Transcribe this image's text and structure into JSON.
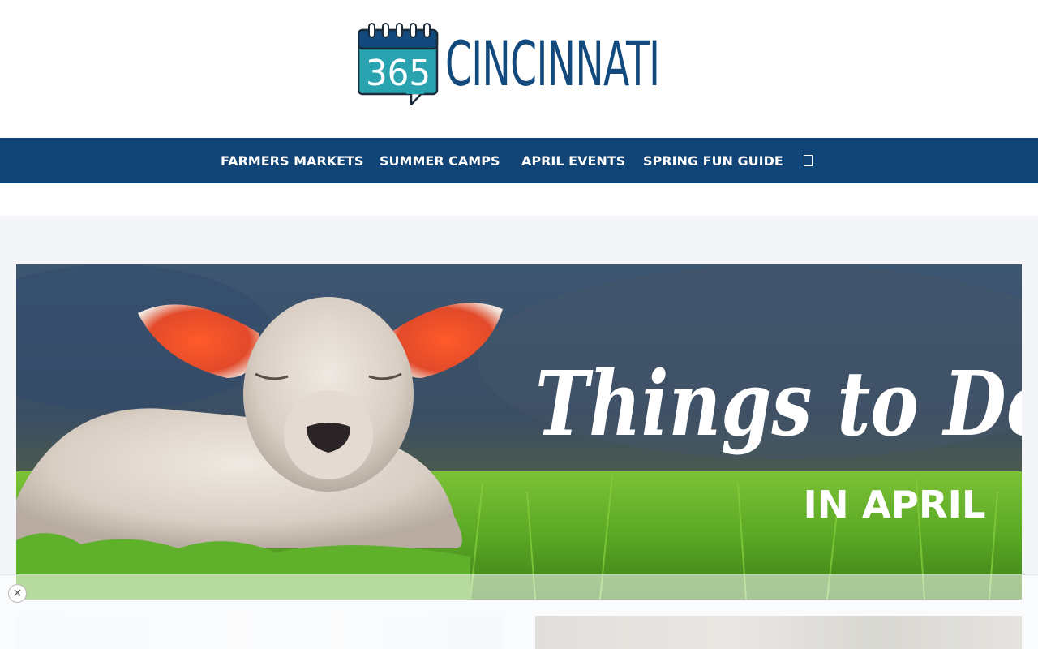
{
  "header": {
    "logo_number": "365",
    "logo_word": "CINCINNATI"
  },
  "nav": {
    "items": [
      {
        "label": "FARMERS MARKETS"
      },
      {
        "label": "SUMMER CAMPS"
      },
      {
        "label": "APRIL EVENTS"
      },
      {
        "label": "SPRING FUN GUIDE"
      }
    ],
    "search_icon": "search-icon"
  },
  "hero": {
    "headline": "Things to Do",
    "subheadline": "IN APRIL"
  },
  "ad": {
    "close_label": "×"
  },
  "colors": {
    "brand_blue": "#124577",
    "logo_teal": "#2aa3b0",
    "logo_navy": "#124a7d",
    "page_bg": "#f4f5f9"
  }
}
